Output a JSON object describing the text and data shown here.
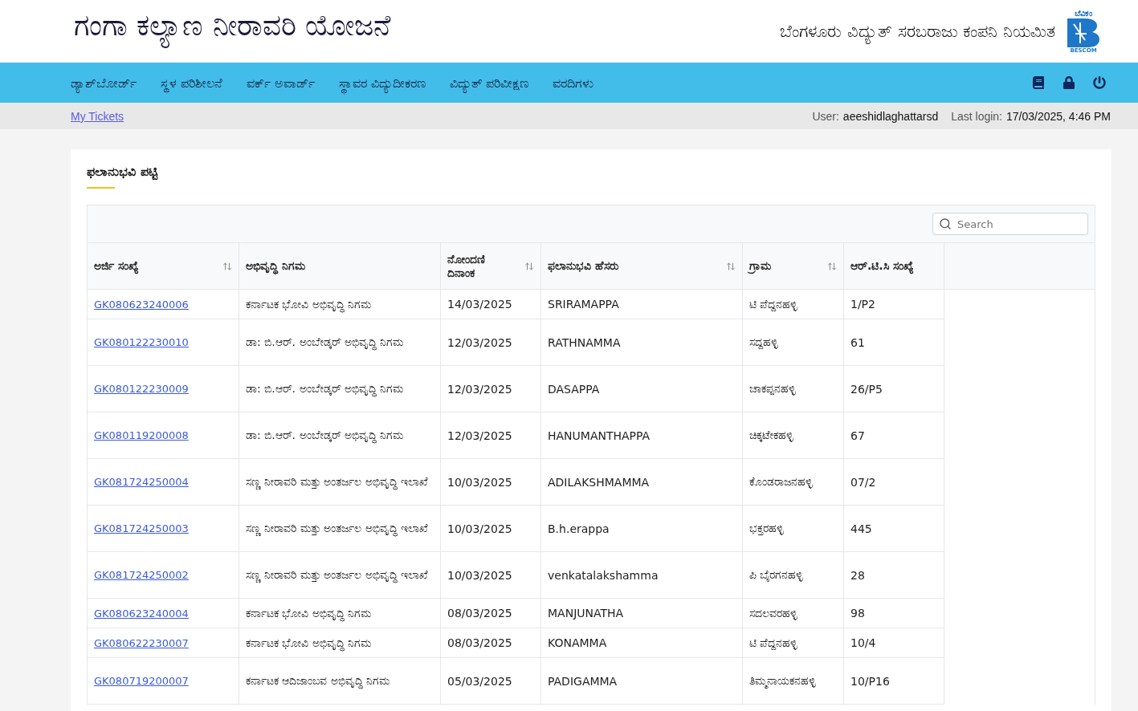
{
  "header": {
    "title": "ಗಂಗಾ ಕಲ್ಯಾಣ ನೀರಾವರಿ ಯೋಜನೆ",
    "company": "ಬೆಂಗಳೂರು ವಿದ್ಯುತ್ ಸರಬರಾಜು ಕಂಪನಿ ನಿಯಮಿತ",
    "logo_top": "ಬೆವಿಕಂ",
    "logo_bottom": "BESCOM"
  },
  "nav": {
    "items": [
      "ಡ್ಯಾಶ್‌ಬೋರ್ಡ್",
      "ಸ್ಥಳ ಪರಿಶೀಲನೆ",
      "ವರ್ಕ್ ಅವಾರ್ಡ್",
      "ಸ್ಥಾವರ ವಿದ್ಯುದೀಕರಣ",
      "ವಿದ್ಯುತ್ ಪರಿವೀಕ್ಷಣ",
      "ವರದಿಗಳು"
    ]
  },
  "sub_bar": {
    "link": "My Tickets",
    "user_label": "User:",
    "user": "aeeshidlaghattarsd",
    "login_label": "Last login:",
    "login": "17/03/2025, 4:46 PM"
  },
  "card": {
    "title": "ಫಲಾನುಭವಿ ಪಟ್ಟಿ"
  },
  "table": {
    "search": {
      "placeholder": "Search"
    },
    "columns": [
      {
        "label": "ಅರ್ಜಿ ಸಂಖ್ಯೆ",
        "sortable": true
      },
      {
        "label": "ಅಭಿವೃದ್ಧಿ ನಿಗಮ",
        "sortable": false
      },
      {
        "label": "ನೋಂದಣಿ ದಿನಾಂಕ",
        "sortable": true
      },
      {
        "label": "ಫಲಾನುಭವಿ ಹೆಸರು",
        "sortable": true
      },
      {
        "label": "ಗ್ರಾಮ",
        "sortable": true
      },
      {
        "label": "ಆರ್.ಟಿ.ಸಿ ಸಂಖ್ಯೆ",
        "sortable": false
      }
    ],
    "rows": [
      [
        "GK080623240006",
        "ಕರ್ನಾಟಕ ಭೋವಿ ಅಭಿವೃದ್ಧಿ ನಿಗಮ",
        "14/03/2025",
        "SRIRAMAPPA",
        "ಟಿ ಪೆದ್ದನಹಳ್ಳಿ",
        "1/P2"
      ],
      [
        "GK080122230010",
        "ಡಾ: ಬಿ.ಆರ್. ಅಂಬೇಡ್ಕರ್ ಅಭಿವೃದ್ಧಿ ನಿಗಮ",
        "12/03/2025",
        "RATHNAMMA",
        "ಸದ್ದಹಳ್ಳಿ",
        "61"
      ],
      [
        "GK080122230009",
        "ಡಾ: ಬಿ.ಆರ್. ಅಂಬೇಡ್ಕರ್ ಅಭಿವೃದ್ಧಿ ನಿಗಮ",
        "12/03/2025",
        "DASAPPA",
        "ಚಾಕಪ್ಪನಹಳ್ಳಿ",
        "26/P5"
      ],
      [
        "GK080119200008",
        "ಡಾ: ಬಿ.ಆರ್. ಅಂಬೇಡ್ಕರ್ ಅಭಿವೃದ್ಧಿ ನಿಗಮ",
        "12/03/2025",
        "HANUMANTHAPPA",
        "ಚಿಕ್ಕಟೇಕಹಳ್ಳಿ",
        "67"
      ],
      [
        "GK081724250004",
        "ಸಣ್ಣ ನೀರಾವರಿ ಮತ್ತು ಅಂತರ್ಜಲ ಅಭಿವೃದ್ಧಿ ಇಲಾಖೆ",
        "10/03/2025",
        "ADILAKSHMAMMA",
        "ಕೊಂಡರಾಜನಹಳ್ಳಿ",
        "07/2"
      ],
      [
        "GK081724250003",
        "ಸಣ್ಣ ನೀರಾವರಿ ಮತ್ತು ಅಂತರ್ಜಲ ಅಭಿವೃದ್ಧಿ ಇಲಾಖೆ",
        "10/03/2025",
        "B.h.erappa",
        "ಭಕ್ತರಹಳ್ಳಿ",
        "445"
      ],
      [
        "GK081724250002",
        "ಸಣ್ಣ ನೀರಾವರಿ ಮತ್ತು ಅಂತರ್ಜಲ ಅಭಿವೃದ್ಧಿ ಇಲಾಖೆ",
        "10/03/2025",
        "venkatalakshamma",
        "ಪಿ ಬೈರಗನಹಳ್ಳಿ",
        "28"
      ],
      [
        "GK080623240004",
        "ಕರ್ನಾಟಕ ಭೋವಿ ಅಭಿವೃದ್ಧಿ ನಿಗಮ",
        "08/03/2025",
        "MANJUNATHA",
        "ಸದಲವರಹಳ್ಳಿ",
        "98"
      ],
      [
        "GK080622230007",
        "ಕರ್ನಾಟಕ ಭೋವಿ ಅಭಿವೃದ್ಧಿ ನಿಗಮ",
        "08/03/2025",
        "KONAMMA",
        "ಟಿ ಪೆದ್ದನಹಳ್ಳಿ",
        "10/4"
      ],
      [
        "GK080719200007",
        "ಕರ್ನಾಟಕ ಆದಿಜಾಂಬವ ಅಭಿವೃದ್ಧಿ ನಿಗಮ",
        "05/03/2025",
        "PADIGAMMA",
        "ತಿಮ್ಮನಾಯಕನಹಳ್ಳಿ",
        "10/P16"
      ]
    ]
  }
}
